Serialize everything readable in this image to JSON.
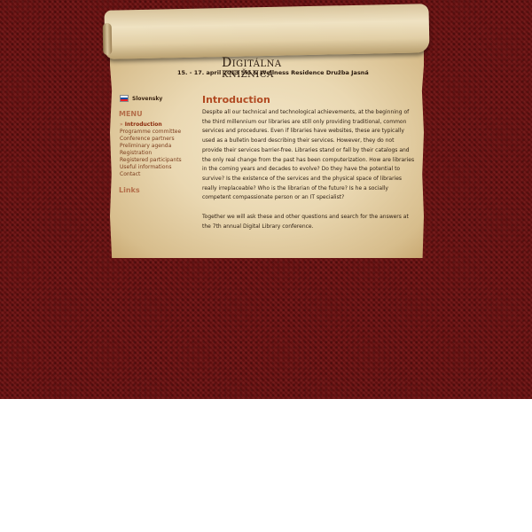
{
  "header": {
    "title_initial": "D",
    "title_rest": "IGITÁLNA  KNIŽNICA",
    "subtitle": "15. - 17. april 2013 Ski & Wellness Residence Družba Jasná"
  },
  "language": {
    "label": "Slovensky",
    "flag_colors": [
      "#ffffff",
      "#0b4ea2",
      "#ee1c25"
    ]
  },
  "sidebar": {
    "menu_heading": "MENU",
    "active_bullet": "»",
    "items": [
      {
        "label": "Introduction"
      },
      {
        "label": "Programme committee"
      },
      {
        "label": "Conference partners"
      },
      {
        "label": "Preliminary agenda"
      },
      {
        "label": "Registration"
      },
      {
        "label": "Registered participants"
      },
      {
        "label": "Useful informations"
      },
      {
        "label": "Contact"
      }
    ],
    "links_heading": "Links"
  },
  "content": {
    "title": "Introduction",
    "paragraph1": "Despite all our technical and technological achievements, at the beginning of the third millennium our libraries are still only providing traditional, common services and procedures. Even if libraries have websites, these are typically used as a bulletin board describing their services. However, they do not provide their services barrier-free. Libraries stand or fall by their catalogs and the only real change from the past has been computerization. How are libraries in the coming years and decades to evolve? Do they have the potential to survive? Is the existence of the services and the physical space of libraries really irreplaceable? Who is the librarian of the future? Is he a socially competent compassionate person or an IT specialist?",
    "paragraph2": "Together we will ask these and other questions and search for the answers at the 7th annual Digital Library conference."
  },
  "colors": {
    "background": "#6e1010",
    "accent": "#b14a22",
    "menu_heading": "#b46e4a",
    "link": "#7a3c1c"
  }
}
